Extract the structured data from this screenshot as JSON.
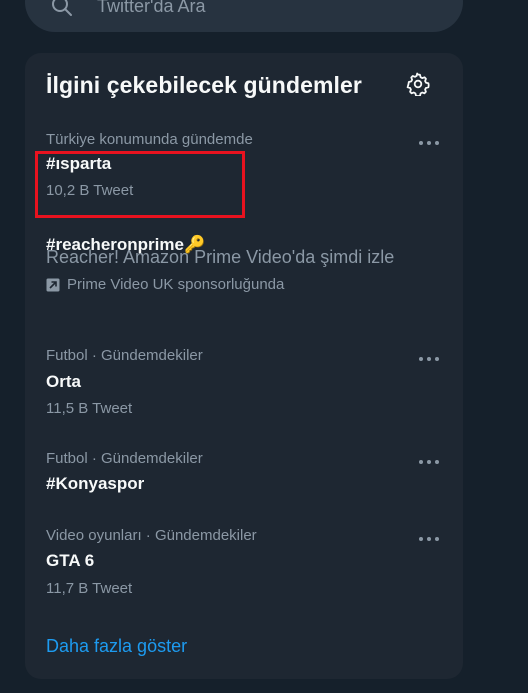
{
  "search": {
    "placeholder": "Twitter'da Ara"
  },
  "panel": {
    "title": "İlgini çekebilecek gündemler",
    "show_more": "Daha fazla göster"
  },
  "trends": [
    {
      "meta": "Türkiye konumunda gündemde",
      "name": "#ısparta",
      "count": "10,2 B Tweet"
    },
    {
      "name": "#reacheronprime",
      "emoji": "🔑",
      "description": "Reacher! Amazon Prime Video'da şimdi izle",
      "promoted": "Prime Video UK sponsorluğunda"
    },
    {
      "meta": "Futbol · Gündemdekiler",
      "name": "Orta",
      "count": "11,5 B Tweet"
    },
    {
      "meta": "Futbol · Gündemdekiler",
      "name": "#Konyaspor"
    },
    {
      "meta": "Video oyunları · Gündemdekiler",
      "name": "GTA 6",
      "count": "11,7 B Tweet"
    }
  ],
  "colors": {
    "background": "#15202b",
    "panel": "#1e2732",
    "accent": "#1d9bf0",
    "muted_text": "#8b98a5",
    "highlight": "#e8121f"
  }
}
